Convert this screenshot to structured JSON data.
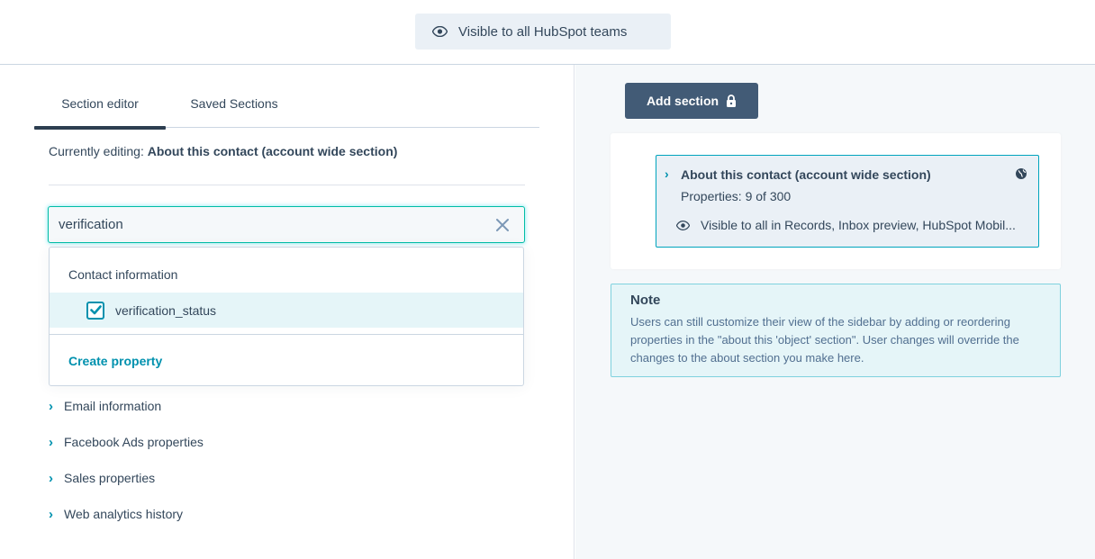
{
  "top": {
    "visibility_label": "Visible to all HubSpot teams"
  },
  "editor": {
    "tabs": [
      {
        "label": "Section editor",
        "active": true
      },
      {
        "label": "Saved Sections",
        "active": false
      }
    ],
    "currently_editing_prefix": "Currently editing:",
    "currently_editing_value": "About this contact (account wide section)",
    "search_value": "verification",
    "dropdown": {
      "group_label": "Contact information",
      "options": [
        {
          "label": "verification_status",
          "checked": true
        }
      ],
      "create_label": "Create property"
    },
    "property_groups": [
      {
        "label": "Email information"
      },
      {
        "label": "Facebook Ads properties"
      },
      {
        "label": "Sales properties"
      },
      {
        "label": "Web analytics history"
      }
    ]
  },
  "preview": {
    "add_section_label": "Add section",
    "section": {
      "title": "About this contact (account wide section)",
      "properties": "Properties: 9 of 300",
      "visibility": "Visible to all in Records, Inbox preview, HubSpot Mobil..."
    },
    "note": {
      "title": "Note",
      "body": "Users can still customize their view of the sidebar by adding or reordering properties in the \"about this 'object' section\". User changes will override the changes to the about section you make here."
    }
  },
  "colors": {
    "accent": "#0091ae",
    "focus_border": "#00bda5",
    "button_dark": "#425b76",
    "text": "#33475b"
  }
}
